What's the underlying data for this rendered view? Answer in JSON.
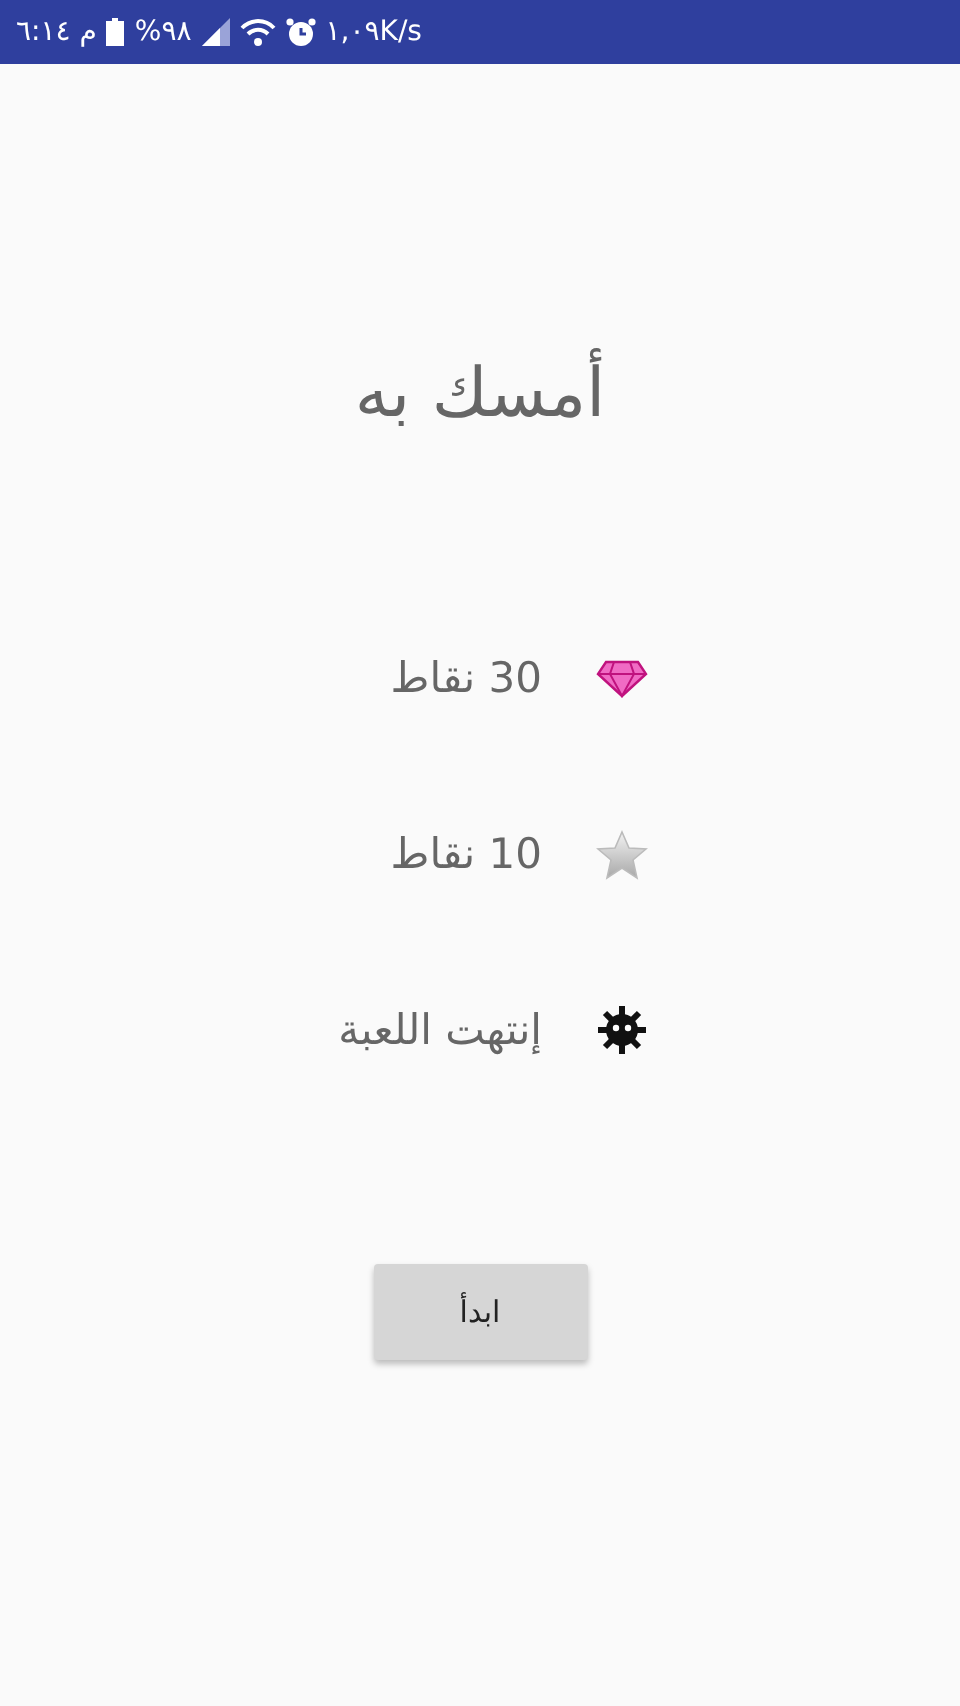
{
  "status_bar": {
    "time": "م ٦:١٤",
    "battery": "%٩٨",
    "speed": "١,٠٩K/s"
  },
  "title": "أمسك به",
  "items": [
    {
      "kind": "gem",
      "label": "30 نقاط"
    },
    {
      "kind": "star",
      "label": "10 نقاط"
    },
    {
      "kind": "virus",
      "label": "إنتهت اللعبة"
    }
  ],
  "start_button": "ابدأ"
}
